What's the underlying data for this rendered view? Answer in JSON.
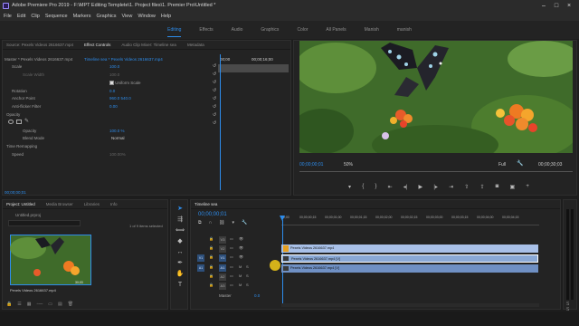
{
  "window": {
    "title": "Adobe Premiere Pro 2019 - F:\\MPT Editing Templete\\1. Project files\\1. Premier Pro\\Untitled *"
  },
  "menu": [
    "File",
    "Edit",
    "Clip",
    "Sequence",
    "Markers",
    "Graphics",
    "View",
    "Window",
    "Help"
  ],
  "workspaces": {
    "items": [
      "Editing",
      "Effects",
      "Audio",
      "Graphics",
      "Color",
      "All Panels",
      "Manish",
      "manish"
    ],
    "active": 0
  },
  "effect_controls": {
    "tabs": [
      "Source: Pexels Videos 2616637.mp4",
      "Effect Controls",
      "Audio Clip Mixer: Timeline sea",
      "Metadata"
    ],
    "active_tab": 1,
    "master_label": "Master * Pexels Videos 2616637.mp4",
    "sequence_label": "Timeline sea * Pexels Videos 2616637.mp4",
    "time_start": "00;00",
    "time_mid": "00;00;16;00",
    "rows": [
      {
        "label": "Scale",
        "value": "100.0"
      },
      {
        "label": "Scale Width",
        "value": "100.0"
      },
      {
        "label": "Uniform Scale",
        "value": ""
      },
      {
        "label": "Rotation",
        "value": "0.0"
      },
      {
        "label": "Anchor Point",
        "value": "960.0   540.0"
      },
      {
        "label": "Anti-flicker Filter",
        "value": "0.00"
      },
      {
        "label": "Opacity",
        "value": ""
      },
      {
        "label": "Opacity",
        "value": "100.0 %"
      },
      {
        "label": "Blend Mode",
        "value": "Normal"
      },
      {
        "label": "Time Remapping",
        "value": ""
      },
      {
        "label": "Speed",
        "value": "100.00%"
      }
    ],
    "timecode": "00;00;00;01"
  },
  "program": {
    "timecode": "00;00;00;01",
    "zoom": "50%",
    "quality": "Full",
    "duration": "00;00;30;03"
  },
  "project": {
    "tabs": [
      "Project: Untitled",
      "Media Browser",
      "Libraries",
      "Info"
    ],
    "active_tab": 0,
    "name": "Untitled.prproj",
    "selection": "1 of 9 items selected",
    "clip_name": "Pexels Videos 2616637.mp4",
    "clip_duration": "30;03"
  },
  "timeline": {
    "tab": "Timeline sea",
    "timecode": "00;00;00;01",
    "ruler": [
      "00;00",
      "00;00;00;15",
      "00;00;01;00",
      "00;00;01;15",
      "00;00;02;00",
      "00;00;02;15",
      "00;00;03;00",
      "00;00;03;15",
      "00;00;04;00",
      "00;00;04;15"
    ],
    "video_tracks": [
      "V3",
      "V2",
      "V1"
    ],
    "audio_tracks": [
      "A1",
      "A2",
      "A3"
    ],
    "master_label": "Master",
    "master_value": "0.0",
    "clips": [
      {
        "label": "Pexels Videos 2616637.mp4",
        "track": "V3"
      },
      {
        "label": "Pexels Videos 2616637.mp4 [V]",
        "track": "V2"
      },
      {
        "label": "Pexels Videos 2616637.mp4 [V]",
        "track": "V1"
      }
    ]
  },
  "colors": {
    "accent": "#2d8ceb",
    "video_clip": "#8aa9d6",
    "cursor": "#e8c21a"
  }
}
